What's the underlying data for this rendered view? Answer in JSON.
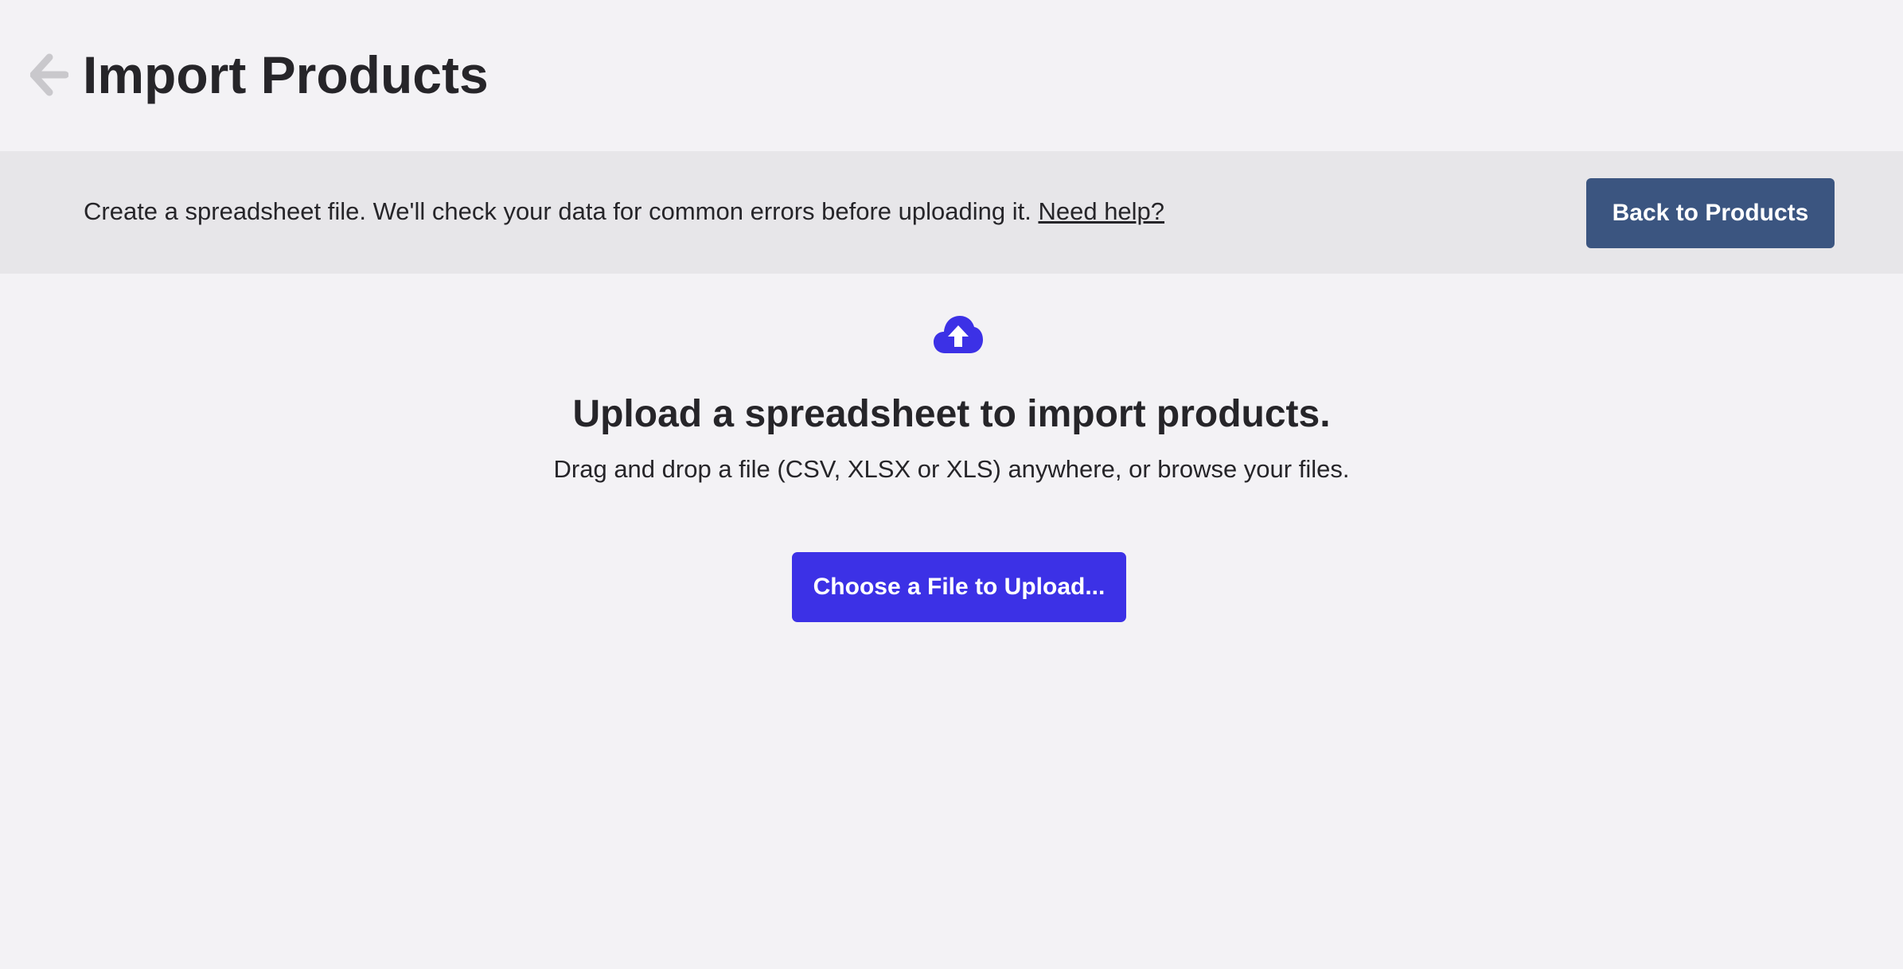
{
  "header": {
    "title": "Import Products",
    "back_icon": "arrow-left-icon"
  },
  "banner": {
    "text": "Create a spreadsheet file. We'll check your data for common errors before uploading it.",
    "help_link": "Need help?",
    "back_button": "Back to Products"
  },
  "upload": {
    "icon": "cloud-upload-icon",
    "title": "Upload a spreadsheet to import products.",
    "subtitle": "Drag and drop a file (CSV, XLSX or XLS) anywhere, or browse your files.",
    "button": "Choose a File to Upload..."
  },
  "colors": {
    "background": "#f3f2f5",
    "banner": "#e7e6e9",
    "back_button": "#3b5580",
    "primary": "#3c31e6",
    "muted_icon": "#c9c8cc",
    "text": "#262529"
  }
}
